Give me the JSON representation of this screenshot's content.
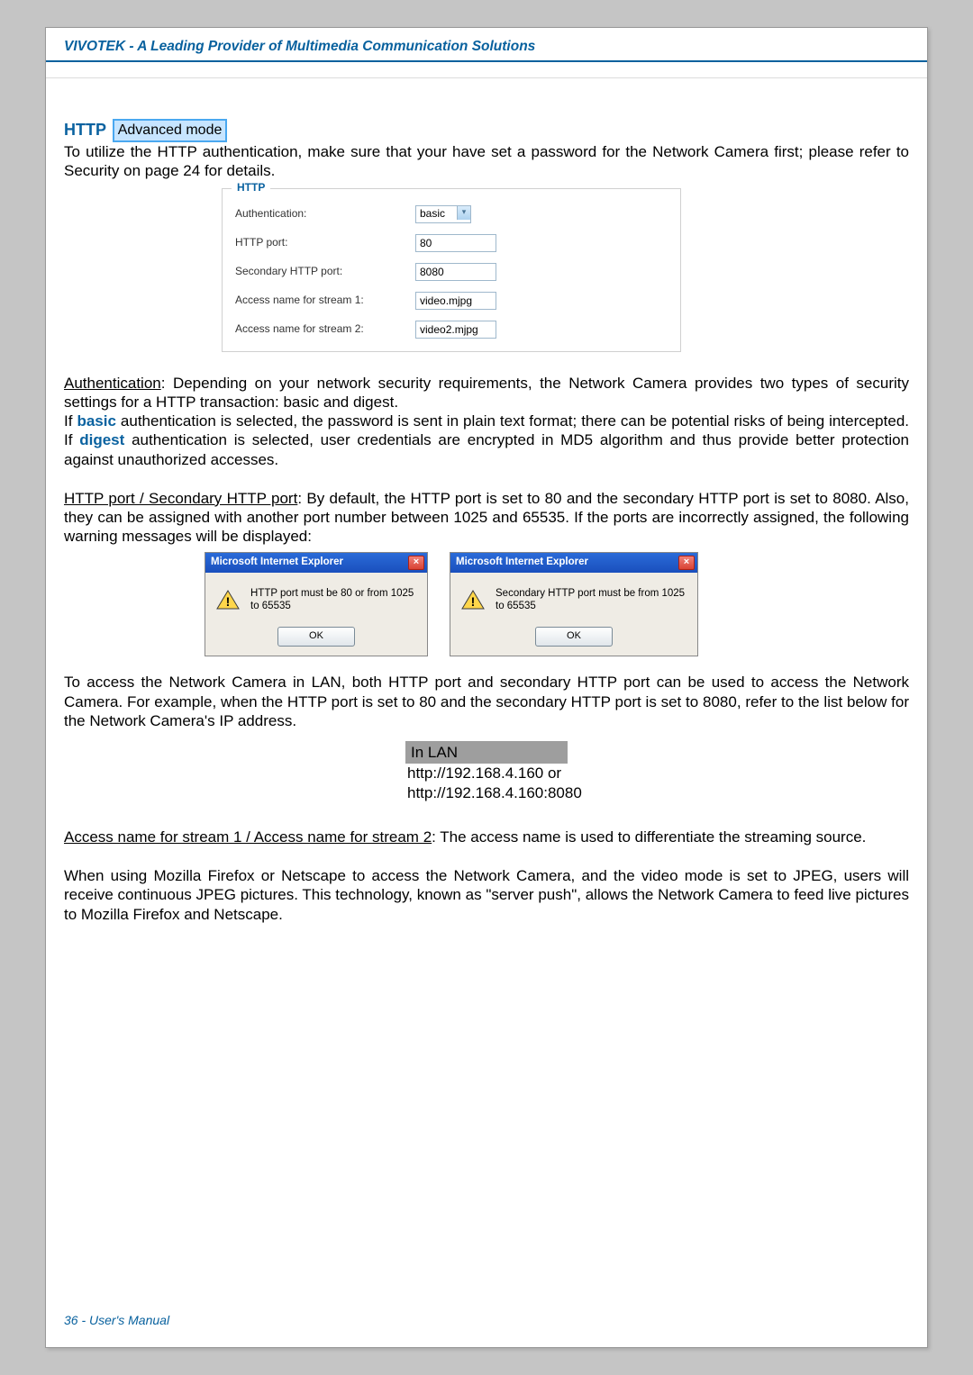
{
  "header": {
    "brand": "VIVOTEK - A Leading Provider of Multimedia Communication Solutions"
  },
  "section": {
    "title": "HTTP",
    "badge": "Advanced mode"
  },
  "intro": "To utilize the HTTP authentication, make sure that your have set a password for the Network Camera first; please refer to Security on page 24 for details.",
  "httpForm": {
    "legend": "HTTP",
    "rows": {
      "auth": {
        "label": "Authentication:",
        "value": "basic"
      },
      "port": {
        "label": "HTTP port:",
        "value": "80"
      },
      "secport": {
        "label": "Secondary HTTP port:",
        "value": "8080"
      },
      "s1": {
        "label": "Access name for stream 1:",
        "value": "video.mjpg"
      },
      "s2": {
        "label": "Access name for stream 2:",
        "value": "video2.mjpg"
      }
    }
  },
  "auth": {
    "lead": "Authentication",
    "text1": ": Depending on your network security requirements, the Network Camera provides two types of security settings for a HTTP transaction: basic and digest.",
    "if_prefix": "If ",
    "basic": "basic",
    "text2": " authentication is selected, the password is sent in plain text format; there can be potential risks of being intercepted. If ",
    "digest": "digest",
    "text3": " authentication is selected, user credentials are encrypted in MD5 algorithm and thus provide better protection against unauthorized accesses."
  },
  "ports": {
    "lead": "HTTP port / Secondary HTTP port",
    "text": ": By default, the HTTP port is set to 80 and the secondary HTTP port is set to 8080. Also, they can be assigned with another port number between 1025 and 65535. If the ports are incorrectly assigned, the following warning messages will be displayed:"
  },
  "dialogs": {
    "title": "Microsoft Internet Explorer",
    "ok": "OK",
    "close": "×",
    "msg1": "HTTP port must be 80 or from 1025 to 65535",
    "msg2": "Secondary HTTP port must be from 1025 to 65535"
  },
  "lanIntro": "To access the Network Camera in LAN, both HTTP port and secondary HTTP port can be used to access the Network Camera. For example, when the HTTP port is set to 80 and the secondary HTTP port is set to 8080, refer to the list below for the Network Camera's IP address.",
  "lanTable": {
    "head": "In LAN",
    "line1": "http://192.168.4.160  or",
    "line2": "http://192.168.4.160:8080"
  },
  "access": {
    "lead": "Access name for stream 1 / Access name for stream 2",
    "text": ": The access name is used to differentiate the streaming source."
  },
  "firefox": "When using Mozilla Firefox or Netscape to access the Network Camera, and the video mode is set to JPEG, users will receive continuous JPEG pictures. This technology, known as \"server push\", allows the Network Camera to feed live pictures to Mozilla Firefox and Netscape.",
  "footer": "36 - User's Manual"
}
